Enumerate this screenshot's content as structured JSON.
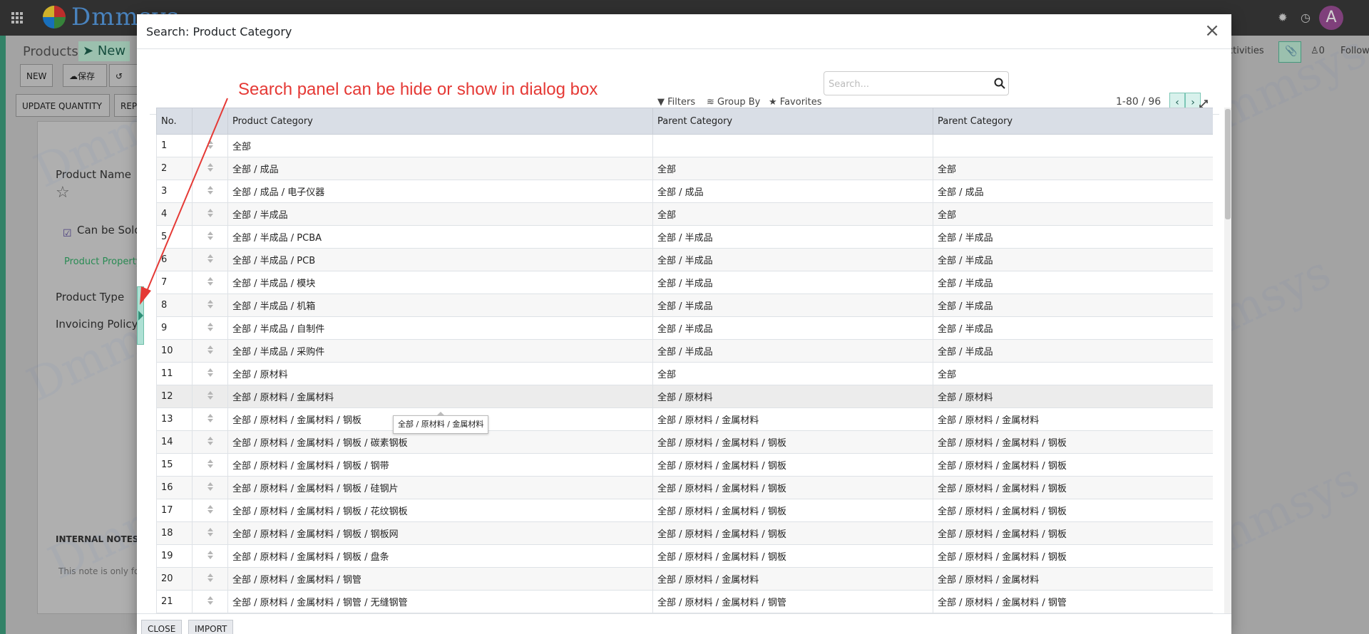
{
  "topbar": {
    "logo_text": "Dmmsys",
    "avatar_initial": "A",
    "icons": [
      "apps-grid-icon",
      "bug-icon",
      "clock-icon"
    ]
  },
  "background": {
    "breadcrumb_products": "Products",
    "breadcrumb_new": "New",
    "btn_new": "NEW",
    "btn_save": "保存",
    "btn_discard": "丢",
    "btn_update_qty": "UPDATE QUANTITY",
    "btn_rep": "REP",
    "product_name_label": "Product Name",
    "can_be_sold": "Can be Sold",
    "product_property": "Product Property",
    "product_type": "Product Type",
    "invoicing_policy": "Invoicing Policy",
    "internal_notes": "INTERNAL NOTES",
    "note_text": "This note is only fo",
    "activities": "ctivities",
    "followers_count": "0",
    "follow": "Follow"
  },
  "dialog": {
    "title": "Search: Product Category",
    "search_placeholder": "Search...",
    "filters": "Filters",
    "group_by": "Group By",
    "favorites": "Favorites",
    "pager": "1-80 / 96",
    "close_label": "CLOSE",
    "import_label": "IMPORT",
    "annotation": "Search panel can be hide or show in dialog box",
    "tooltip": "全部 / 原材料 / 金属材料"
  },
  "table": {
    "headers": [
      "No.",
      "",
      "Product Category",
      "Parent Category",
      "Parent Category"
    ],
    "rows": [
      [
        "1",
        "全部",
        "",
        ""
      ],
      [
        "2",
        "全部 / 成品",
        "全部",
        "全部"
      ],
      [
        "3",
        "全部 / 成品 / 电子仪器",
        "全部 / 成品",
        "全部 / 成品"
      ],
      [
        "4",
        "全部 / 半成品",
        "全部",
        "全部"
      ],
      [
        "5",
        "全部 / 半成品 / PCBA",
        "全部 / 半成品",
        "全部 / 半成品"
      ],
      [
        "6",
        "全部 / 半成品 / PCB",
        "全部 / 半成品",
        "全部 / 半成品"
      ],
      [
        "7",
        "全部 / 半成品 / 模块",
        "全部 / 半成品",
        "全部 / 半成品"
      ],
      [
        "8",
        "全部 / 半成品 / 机箱",
        "全部 / 半成品",
        "全部 / 半成品"
      ],
      [
        "9",
        "全部 / 半成品 / 自制件",
        "全部 / 半成品",
        "全部 / 半成品"
      ],
      [
        "10",
        "全部 / 半成品 / 采购件",
        "全部 / 半成品",
        "全部 / 半成品"
      ],
      [
        "11",
        "全部 / 原材料",
        "全部",
        "全部"
      ],
      [
        "12",
        "全部 / 原材料 / 金属材料",
        "全部 / 原材料",
        "全部 / 原材料"
      ],
      [
        "13",
        "全部 / 原材料 / 金属材料 / 钢板",
        "全部 / 原材料 / 金属材料",
        "全部 / 原材料 / 金属材料"
      ],
      [
        "14",
        "全部 / 原材料 / 金属材料 / 钢板 / 碳素钢板",
        "全部 / 原材料 / 金属材料 / 钢板",
        "全部 / 原材料 / 金属材料 / 钢板"
      ],
      [
        "15",
        "全部 / 原材料 / 金属材料 / 钢板 / 钢带",
        "全部 / 原材料 / 金属材料 / 钢板",
        "全部 / 原材料 / 金属材料 / 钢板"
      ],
      [
        "16",
        "全部 / 原材料 / 金属材料 / 钢板 / 硅钢片",
        "全部 / 原材料 / 金属材料 / 钢板",
        "全部 / 原材料 / 金属材料 / 钢板"
      ],
      [
        "17",
        "全部 / 原材料 / 金属材料 / 钢板 / 花纹钢板",
        "全部 / 原材料 / 金属材料 / 钢板",
        "全部 / 原材料 / 金属材料 / 钢板"
      ],
      [
        "18",
        "全部 / 原材料 / 金属材料 / 钢板 / 钢板网",
        "全部 / 原材料 / 金属材料 / 钢板",
        "全部 / 原材料 / 金属材料 / 钢板"
      ],
      [
        "19",
        "全部 / 原材料 / 金属材料 / 钢板 / 盘条",
        "全部 / 原材料 / 金属材料 / 钢板",
        "全部 / 原材料 / 金属材料 / 钢板"
      ],
      [
        "20",
        "全部 / 原材料 / 金属材料 / 钢管",
        "全部 / 原材料 / 金属材料",
        "全部 / 原材料 / 金属材料"
      ],
      [
        "21",
        "全部 / 原材料 / 金属材料 / 钢管 / 无缝钢管",
        "全部 / 原材料 / 金属材料 / 钢管",
        "全部 / 原材料 / 金属材料 / 钢管"
      ]
    ]
  },
  "colors": {
    "accent": "#7cc7b6",
    "annotation": "#e53935",
    "header_bg": "#d9dee6"
  }
}
